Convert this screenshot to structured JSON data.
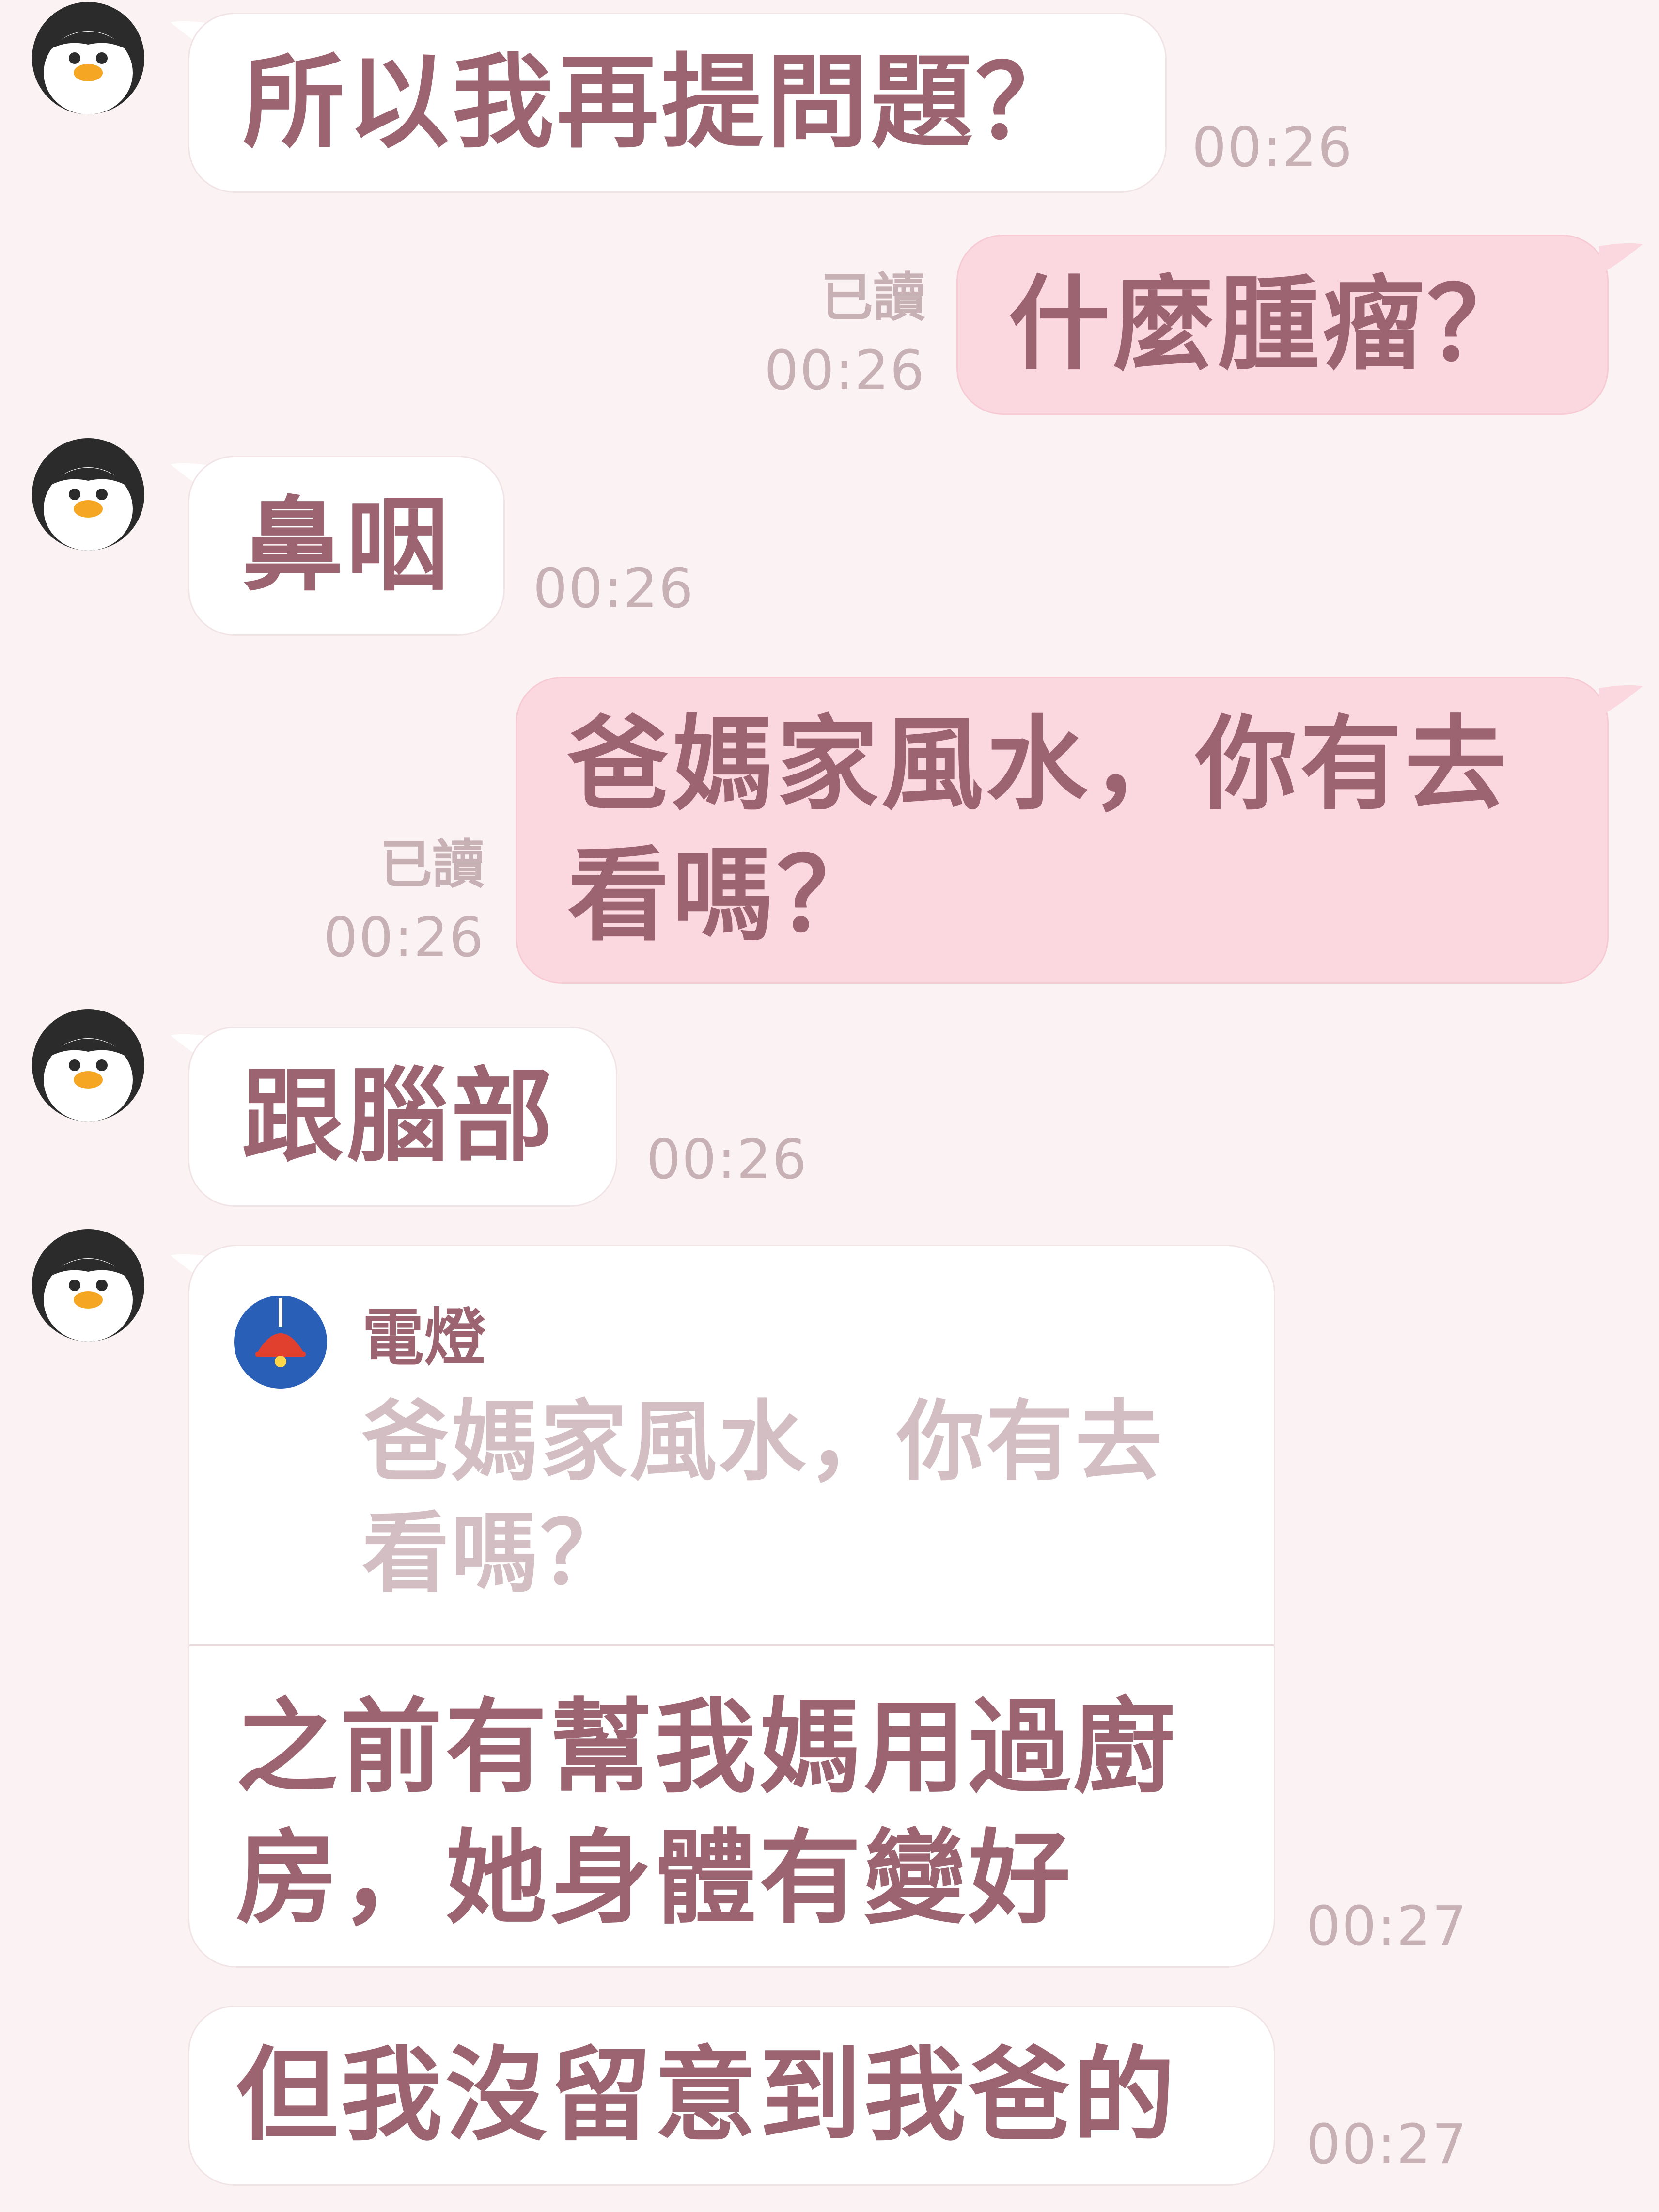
{
  "messages": [
    {
      "text": "所以我再提問題？",
      "time": "00:26"
    },
    {
      "text": "什麼腫瘤？",
      "read": "已讀",
      "time": "00:26"
    },
    {
      "text": "鼻咽",
      "time": "00:26"
    },
    {
      "text": "爸媽家風水，你有去看嗎？",
      "read": "已讀",
      "time": "00:26"
    },
    {
      "text": "跟腦部",
      "time": "00:26"
    },
    {
      "quote_name": "電燈",
      "quote_text": "爸媽家風水，你有去看嗎？",
      "text": "之前有幫我媽用過廚房，她身體有變好",
      "time": "00:27"
    },
    {
      "text": "但我沒留意到我爸的",
      "time": "00:27"
    }
  ],
  "colors": {
    "background": "#fbf3f3",
    "incoming_bubble": "#ffffff",
    "outgoing_bubble": "#fbd7df",
    "text": "#9b6470",
    "meta": "#c7b1b5"
  },
  "icons": {
    "avatar": "penguin-avatar",
    "quote_avatar": "lamp-icon"
  }
}
